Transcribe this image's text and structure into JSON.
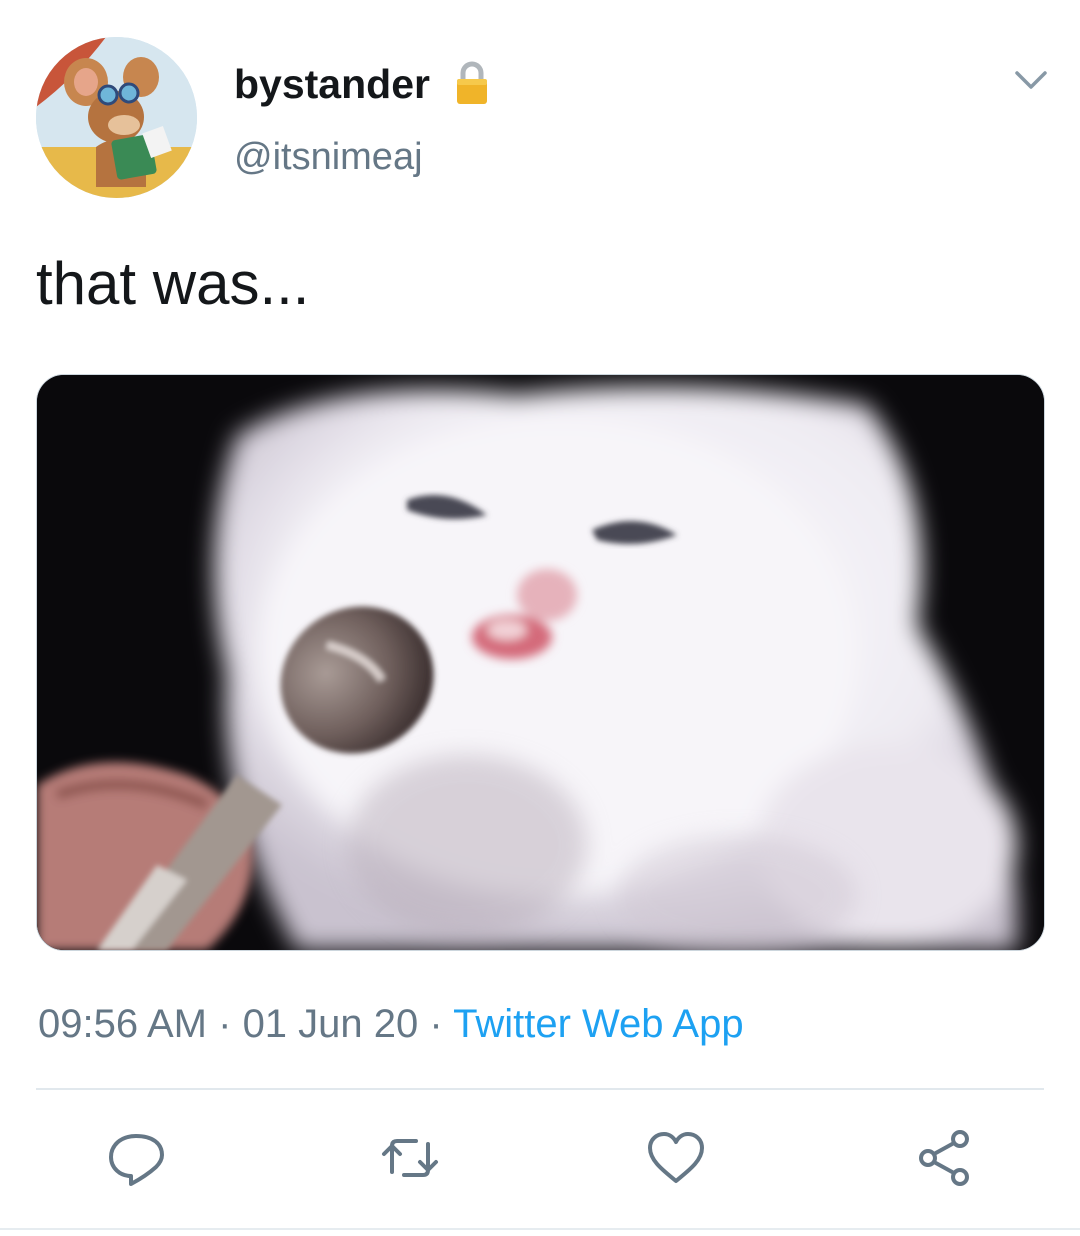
{
  "user": {
    "display_name": "bystander",
    "handle": "@itsnimeaj",
    "protected_icon": "lock-icon",
    "avatar_icon": "avatar"
  },
  "tweet": {
    "text": "that was..."
  },
  "meta": {
    "time": "09:56 AM",
    "separator1": " · ",
    "date": "01 Jun 20",
    "separator2": " · ",
    "source": "Twitter Web App"
  },
  "actions": [
    {
      "name": "reply",
      "icon": "reply-icon"
    },
    {
      "name": "retweet",
      "icon": "retweet-icon"
    },
    {
      "name": "like",
      "icon": "heart-icon"
    },
    {
      "name": "share",
      "icon": "share-icon"
    }
  ],
  "colors": {
    "accent": "#1da1f2",
    "text": "#14171a",
    "secondary_text": "#657786",
    "lock": "#f0b429"
  }
}
